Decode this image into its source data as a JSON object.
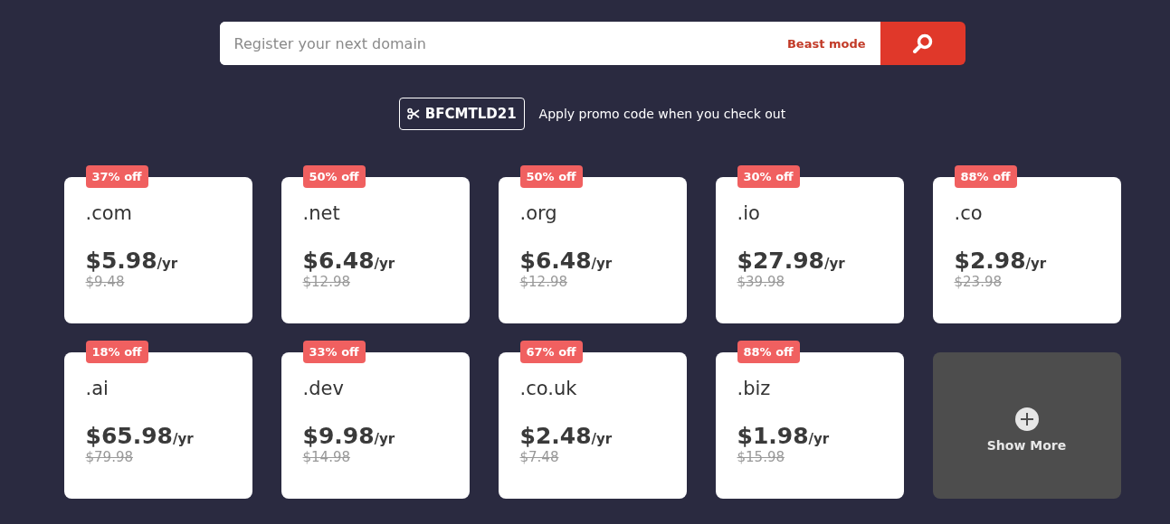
{
  "search": {
    "placeholder": "Register your next domain",
    "mode_link": "Beast mode"
  },
  "promo": {
    "code": "BFCMTLD21",
    "note": "Apply promo code when you check out"
  },
  "domains": [
    {
      "kind": "deal",
      "badge": "37% off",
      "tld": ".com",
      "price": "$5.98",
      "unit": "/yr",
      "old_price": "$9.48"
    },
    {
      "kind": "deal",
      "badge": "50% off",
      "tld": ".net",
      "price": "$6.48",
      "unit": "/yr",
      "old_price": "$12.98"
    },
    {
      "kind": "deal",
      "badge": "50% off",
      "tld": ".org",
      "price": "$6.48",
      "unit": "/yr",
      "old_price": "$12.98"
    },
    {
      "kind": "deal",
      "badge": "30% off",
      "tld": ".io",
      "price": "$27.98",
      "unit": "/yr",
      "old_price": "$39.98"
    },
    {
      "kind": "deal",
      "badge": "88% off",
      "tld": ".co",
      "price": "$2.98",
      "unit": "/yr",
      "old_price": "$23.98"
    },
    {
      "kind": "deal",
      "badge": "18% off",
      "tld": ".ai",
      "price": "$65.98",
      "unit": "/yr",
      "old_price": "$79.98"
    },
    {
      "kind": "deal",
      "badge": "33% off",
      "tld": ".dev",
      "price": "$9.98",
      "unit": "/yr",
      "old_price": "$14.98"
    },
    {
      "kind": "deal",
      "badge": "67% off",
      "tld": ".co.uk",
      "price": "$2.48",
      "unit": "/yr",
      "old_price": "$7.48"
    },
    {
      "kind": "deal",
      "badge": "88% off",
      "tld": ".biz",
      "price": "$1.98",
      "unit": "/yr",
      "old_price": "$15.98"
    },
    {
      "kind": "more",
      "label": "Show More"
    }
  ]
}
